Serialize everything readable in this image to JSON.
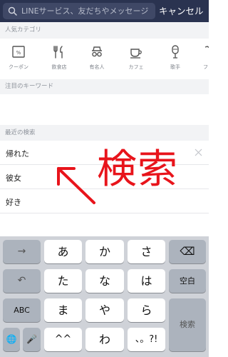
{
  "search": {
    "placeholder": "LINEサービス、友だちやメッセージ",
    "cancel_label": "キャンセル"
  },
  "sections": {
    "popular_categories": "人気カテゴリ",
    "trending_keywords": "注目のキーワード",
    "recent_searches": "最近の検索"
  },
  "categories": [
    {
      "label": "クーポン",
      "icon": "coupon-icon"
    },
    {
      "label": "飲食店",
      "icon": "fork-knife-icon"
    },
    {
      "label": "有名人",
      "icon": "celebrity-icon"
    },
    {
      "label": "カフェ",
      "icon": "cafe-cup-icon"
    },
    {
      "label": "歌手",
      "icon": "microphone-icon"
    },
    {
      "label": "ファ",
      "icon": "fashion-icon"
    }
  ],
  "recent": [
    {
      "text": "帰れた",
      "has_delete": true
    },
    {
      "text": "彼女",
      "has_delete": false
    },
    {
      "text": "好き",
      "has_delete": false
    }
  ],
  "annotation": {
    "text": "検索",
    "color": "#e8141b"
  },
  "keyboard": {
    "row1": [
      "→",
      "あ",
      "か",
      "さ",
      "⌫"
    ],
    "row2": [
      "↶",
      "た",
      "な",
      "は",
      "空白"
    ],
    "row3": [
      "ABC",
      "ま",
      "や",
      "ら",
      "検索"
    ],
    "row4": [
      "🌐",
      "🎤",
      "^^",
      "わ",
      "、。?!"
    ]
  },
  "colors": {
    "topbar": "#2a3350",
    "search_box": "#3f4866",
    "accent_red": "#e8141b",
    "keyboard_bg": "#cfd2d8"
  }
}
